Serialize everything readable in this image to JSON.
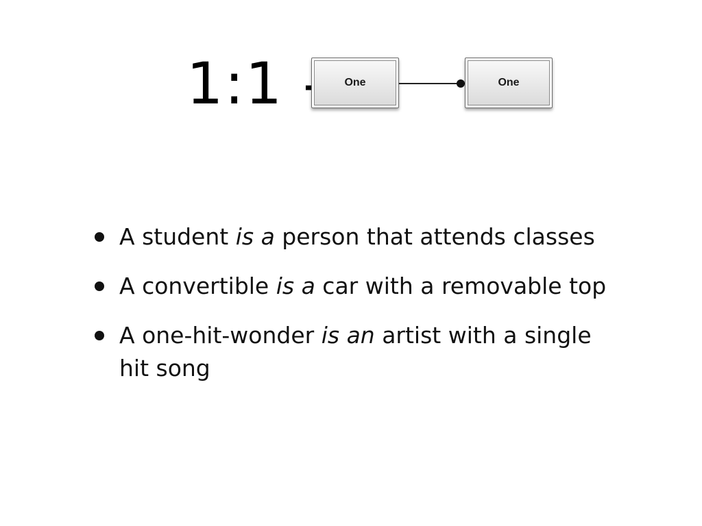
{
  "slide": {
    "title": "1:1 -",
    "diagram": {
      "left_entity": "One",
      "right_entity": "One"
    },
    "bullets": [
      {
        "pre": "A student ",
        "em": "is a",
        "post": " person that attends classes"
      },
      {
        "pre": "A convertible ",
        "em": "is a",
        "post": " car with a removable top"
      },
      {
        "pre": "A one-hit-wonder ",
        "em": "is an",
        "post": " artist with a single hit song"
      }
    ]
  }
}
